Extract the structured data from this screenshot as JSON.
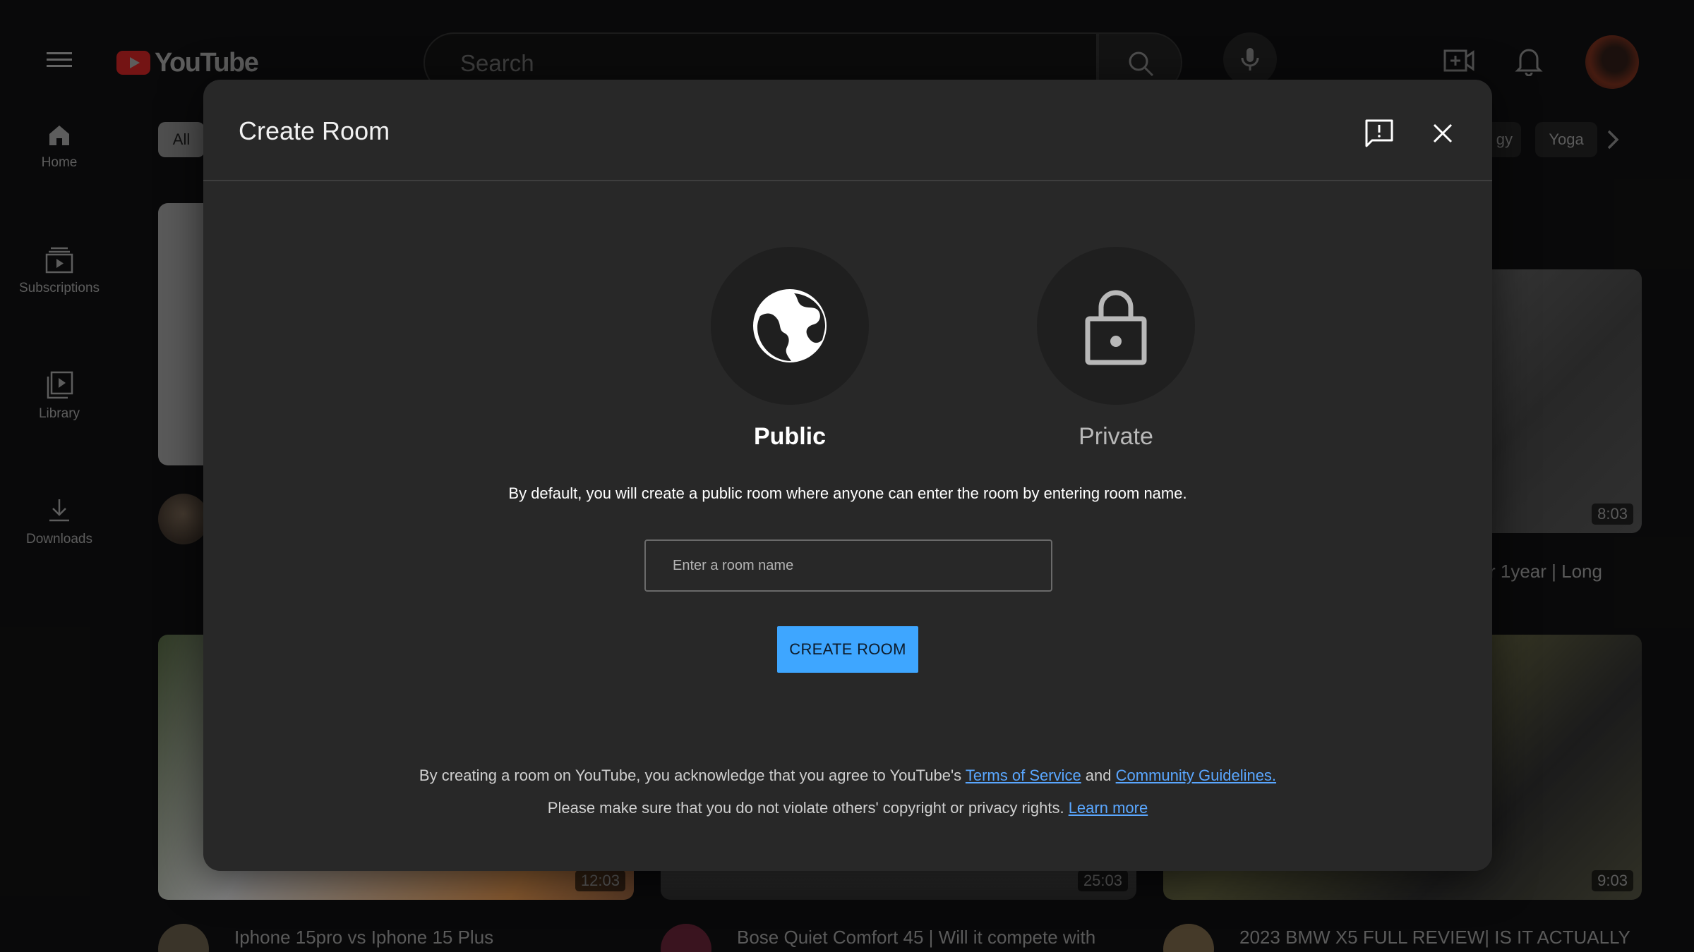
{
  "header": {
    "logo_text": "YouTube",
    "search_placeholder": "Search"
  },
  "sidebar": {
    "items": [
      {
        "label": "Home"
      },
      {
        "label": "Subscriptions"
      },
      {
        "label": "Library"
      },
      {
        "label": "Downloads"
      }
    ]
  },
  "chips": {
    "all": "All",
    "partial": "gy",
    "yoga": "Yoga"
  },
  "videos": {
    "card_top_right": {
      "duration": "8:03",
      "title_fragment": "r 1year | Long"
    },
    "card_bottom_left": {
      "duration": "12:03",
      "title": "Iphone 15pro vs Iphone 15 Plus"
    },
    "card_bottom_mid": {
      "duration": "25:03",
      "title": "Bose Quiet Comfort 45 | Will it compete with"
    },
    "card_bottom_right": {
      "duration": "9:03",
      "title": "2023 BMW X5 FULL REVIEW| IS IT ACTUALLY"
    }
  },
  "modal": {
    "title": "Create Room",
    "options": {
      "public": "Public",
      "private": "Private"
    },
    "description": "By default, you will create a public room where anyone can enter the room by  entering room name.",
    "room_input": {
      "value": "",
      "placeholder": "Enter a room name"
    },
    "create_button": "CREATE ROOM",
    "legal": {
      "line1_prefix": "By creating a room on YouTube, you acknowledge that you agree to YouTube's ",
      "terms_link": "Terms of Service",
      "and_text": " and ",
      "guidelines_link": "Community Guidelines.",
      "line2_prefix": "Please make sure that you do not violate others' copyright or privacy rights. ",
      "learn_more_link": "Learn more"
    }
  },
  "colors": {
    "accent": "#3ea6ff",
    "link": "#5aa7ff",
    "modal_bg": "#282828",
    "page_bg": "#0f0f10"
  }
}
